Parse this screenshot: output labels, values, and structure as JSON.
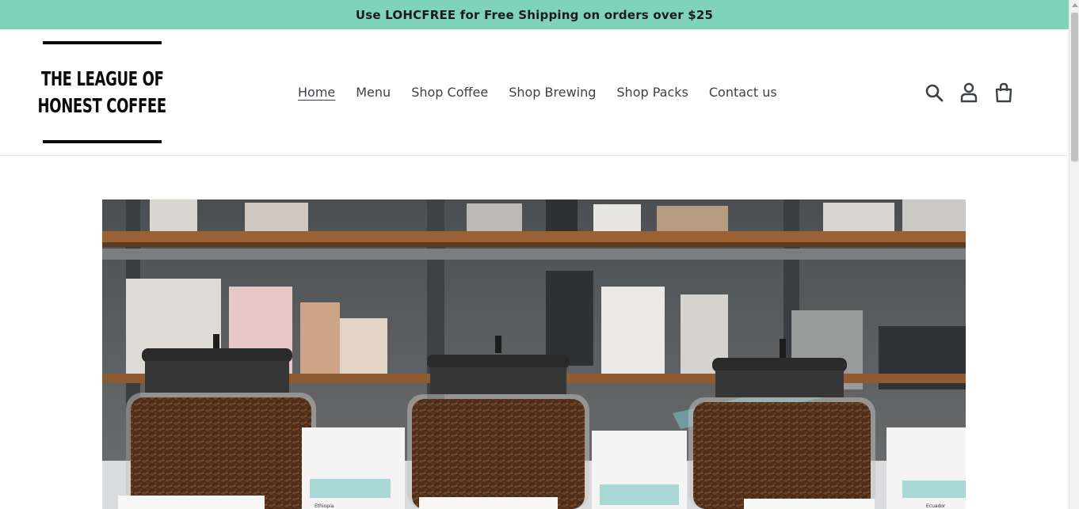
{
  "announcement": {
    "text": "Use LOHCFREE for Free Shipping on orders over $25"
  },
  "logo": {
    "line1": "THE LEAGUE OF",
    "line2": "HONEST COFFEE"
  },
  "nav": {
    "items": [
      {
        "label": "Home",
        "active": true
      },
      {
        "label": "Menu"
      },
      {
        "label": "Shop Coffee"
      },
      {
        "label": "Shop Brewing"
      },
      {
        "label": "Shop Packs"
      },
      {
        "label": "Contact us"
      }
    ]
  },
  "header_icons": [
    "search-icon",
    "account-icon",
    "cart-icon"
  ],
  "hero": {
    "image": "coffee-jars-photo",
    "bag_labels": [
      "Ethiopia",
      "Ecuador"
    ]
  },
  "colors": {
    "announcement_bg": "#7fd3bb",
    "nav_text": "#3d4246",
    "logo": "#0b0b0b"
  }
}
